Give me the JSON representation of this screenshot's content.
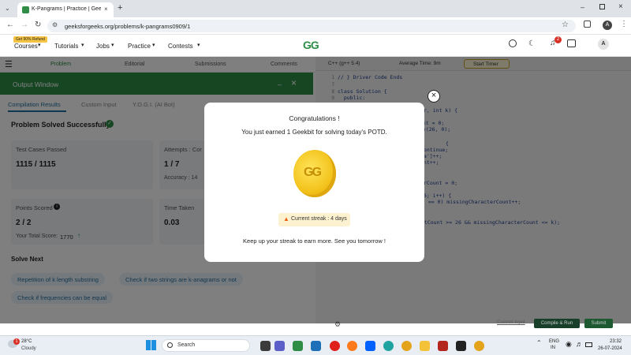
{
  "browser": {
    "tab_title": "K-Pangrams | Practice | GeeksforGeeks",
    "url": "geeksforgeeks.org/problems/k-pangrams0909/1",
    "profile_initial": "A"
  },
  "site": {
    "logo_text": "GG",
    "promo_badge": "Get 90% Refund",
    "nav": [
      "Courses",
      "Tutorials",
      "Jobs",
      "Practice",
      "Contests"
    ],
    "notification_count": "2",
    "avatar_initial": "A"
  },
  "problem_tabs": [
    "Problem",
    "Editorial",
    "Submissions",
    "Comments"
  ],
  "output_window": {
    "title": "Output Window",
    "tabs": [
      "Compilation Results",
      "Custom Input",
      "Y.O.G.I. (AI Bot)"
    ],
    "status": "Problem Solved Successfully",
    "cards": {
      "tests_label": "Test Cases Passed",
      "tests_value": "1115 / 1115",
      "attempts_label": "Attempts : Cor",
      "attempts_value": "1 / 7",
      "accuracy_label": "Accuracy : 14",
      "points_label": "Points Scored",
      "points_value": "2 / 2",
      "total_label": "Your Total Score: ",
      "total_value": "1770",
      "time_label": "Time Taken",
      "time_value": "0.03"
    },
    "solve_next_title": "Solve Next",
    "solve_next": [
      "Repetition of k length substring",
      "Check if two strings are k-anagrams or not",
      "Check if frequencies can be equal"
    ]
  },
  "editor": {
    "language": "C++ (g++ 5.4)",
    "avg_time": "Average Time: 9m",
    "start_timer": "Start Timer",
    "custom_input": "Custom Input",
    "compile_run": "Compile & Run",
    "submit": "Submit",
    "lines": [
      {
        "n": "1",
        "text": "// } Driver Code Ends"
      },
      {
        "n": "7",
        "text": ""
      },
      {
        "n": "8",
        "text": "class Solution {"
      },
      {
        "n": "9",
        "text": "  public:"
      },
      {
        "n": "",
        "text": "r, int k) {"
      },
      {
        "n": "",
        "text": "unt = 0;"
      },
      {
        "n": "",
        "text": "cy(26, 0);"
      },
      {
        "n": "",
        "text": "{"
      },
      {
        "n": "",
        "text": "continue;"
      },
      {
        "n": "",
        "text": "'a']++;"
      },
      {
        "n": "",
        "text": "unt++;"
      },
      {
        "n": "",
        "text": "rCount = 0;"
      },
      {
        "n": "",
        "text": "26; i++) {"
      },
      {
        "n": "",
        "text": "] == 0) missingCharacterCount++;"
      },
      {
        "n": "",
        "text": "etCount >= 26 && missingCharacterCount <= k);"
      }
    ]
  },
  "modal": {
    "title": "Congratulations !",
    "subtitle": "You just earned 1 Geekbit for solving today's POTD.",
    "coin_text": "GG",
    "streak": "Current streak : 4 days",
    "footer": "Keep up your streak to earn more. See you tomorrow !"
  },
  "taskbar": {
    "weather_temp": "28°C",
    "weather_desc": "Cloudy",
    "weather_badge": "1",
    "search": "Search",
    "lang_top": "ENG",
    "lang_bottom": "IN",
    "time": "23:32",
    "date": "26-07-2024"
  },
  "colors": {
    "gfg_green": "#2f8d46",
    "overlay": "#000000",
    "coin": "#f2c21a"
  }
}
